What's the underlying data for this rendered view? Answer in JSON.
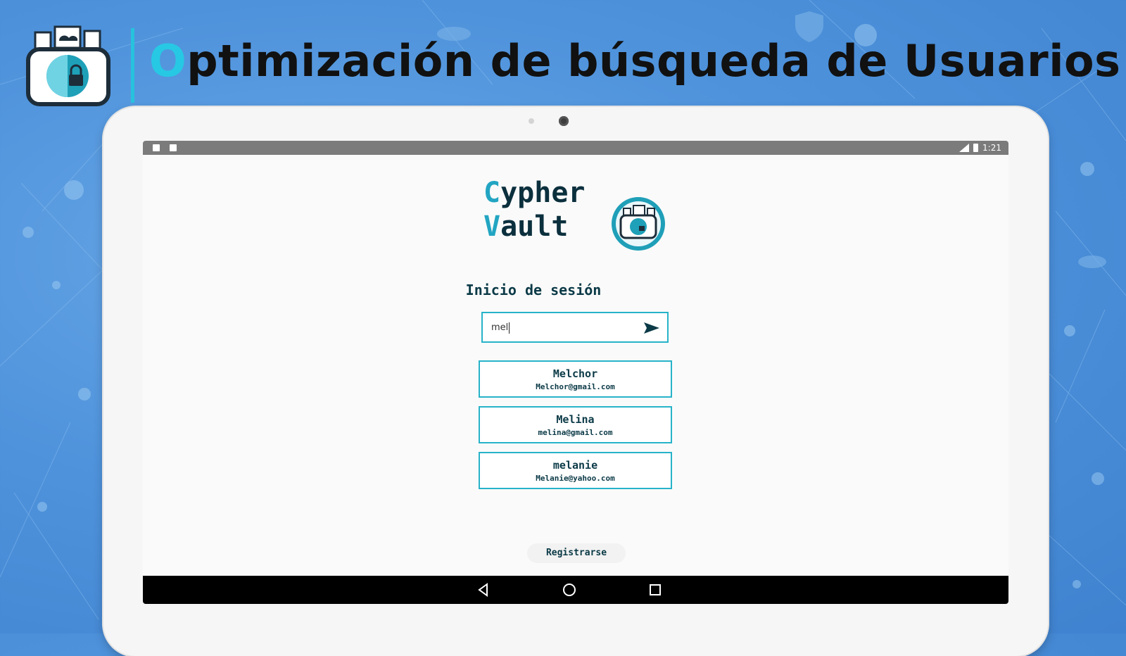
{
  "slide": {
    "title_first_letter": "O",
    "title_rest": "ptimización de búsqueda de Usuarios",
    "accent_color": "#27c8e3"
  },
  "status_bar": {
    "time": "1:21",
    "left_icons": [
      "sd-card-icon",
      "image-icon"
    ],
    "right_icons": [
      "signal-icon",
      "battery-icon"
    ]
  },
  "app": {
    "logo_line1_first": "C",
    "logo_line1_rest": "ypher",
    "logo_line2_first": "V",
    "logo_line2_rest": "ault",
    "login_heading": "Inicio de sesión",
    "search": {
      "value": "mel",
      "send_icon": "send-icon"
    },
    "results": [
      {
        "name": "Melchor",
        "email": "Melchor@gmail.com"
      },
      {
        "name": "Melina",
        "email": "melina@gmail.com"
      },
      {
        "name": "melanie",
        "email": "Melanie@yahoo.com"
      }
    ],
    "register_label": "Registrarse"
  },
  "nav_bar": {
    "buttons": [
      "back-icon",
      "home-icon",
      "recents-icon"
    ]
  }
}
